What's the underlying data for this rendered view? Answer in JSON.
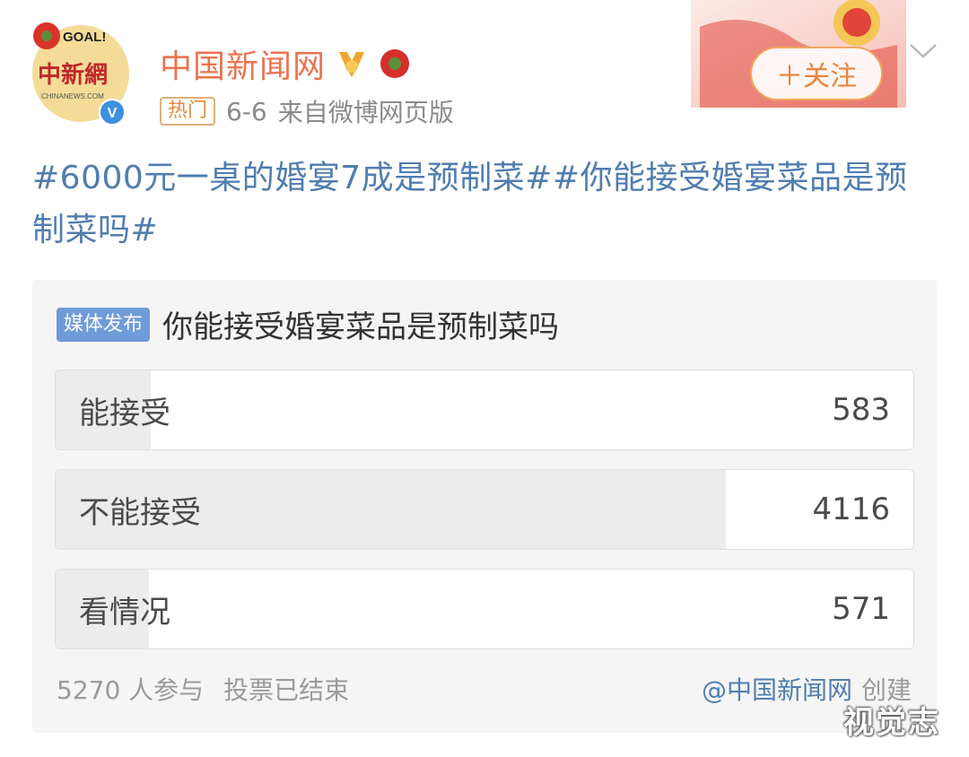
{
  "header": {
    "account_name": "中国新闻网",
    "hot_tag": "热门",
    "date": "6-6",
    "source": "来自微博网页版",
    "follow_label": "＋关注",
    "avatar_logo_text": "中新網",
    "avatar_goal_text": "GOAL!",
    "avatar_site_text": "CHINANEWS.COM",
    "verified_mark": "V",
    "colors": {
      "name": "#eb7350",
      "accent": "#f0a65e",
      "link": "#507daf"
    }
  },
  "post": {
    "text": "#6000元一桌的婚宴7成是预制菜##你能接受婚宴菜品是预制菜吗#"
  },
  "poll": {
    "badge": "媒体发布",
    "title": "你能接受婚宴菜品是预制菜吗",
    "options": [
      {
        "label": "能接受",
        "count": "583",
        "votes": 583
      },
      {
        "label": "不能接受",
        "count": "4116",
        "votes": 4116
      },
      {
        "label": "看情况",
        "count": "571",
        "votes": 571
      }
    ],
    "participants": "5270 人参与",
    "status": "投票已结束",
    "creator": "@中国新闻网",
    "created_label": "创建"
  },
  "watermark": "视觉志",
  "icons": [
    "dropdown-chevron-icon",
    "verified-icon",
    "medal-icon",
    "flower-icon"
  ]
}
